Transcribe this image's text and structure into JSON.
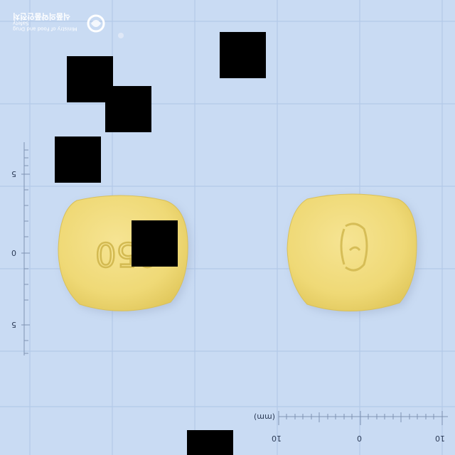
{
  "logo": {
    "line1": "Ministry of Food and Drug Safety",
    "line2": "식품의약품안전처"
  },
  "scale": {
    "unit": "(mm)",
    "bottom_ticks": [
      "10",
      "0",
      "10"
    ],
    "left_ticks": [
      "5",
      "0",
      "5"
    ]
  },
  "pill": {
    "color": "#f1dc7c",
    "left_imprint": "050",
    "right_mark": "logo-imprint"
  },
  "colors": {
    "background": "#c9dbf3",
    "grid": "#b3c9e8",
    "ruler": "#7f93b3"
  }
}
